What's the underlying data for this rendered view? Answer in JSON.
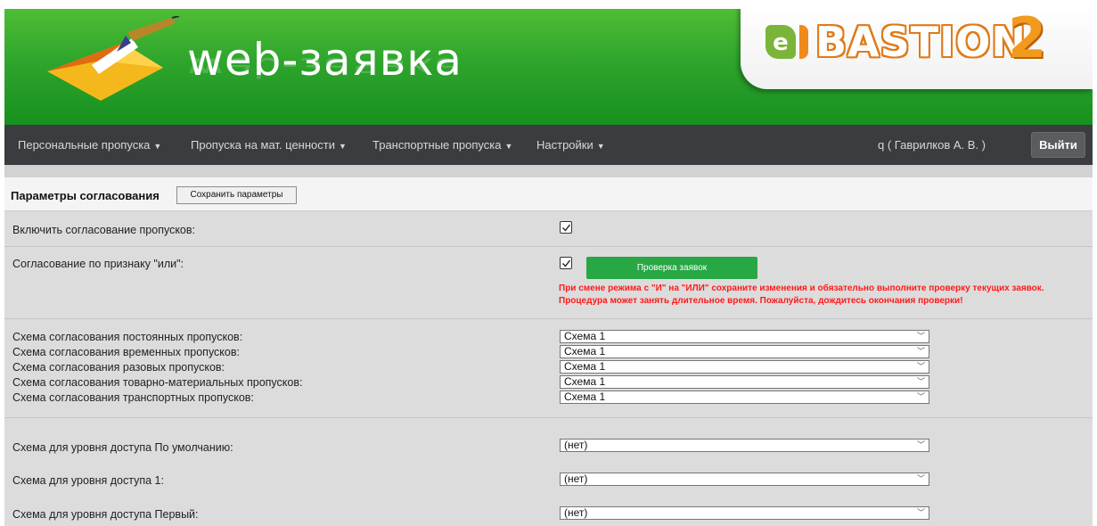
{
  "brand": {
    "app_name": "web-заявка",
    "partner_logo_text": "BASTION",
    "partner_logo_number": "2",
    "partner_logo_letter": "e"
  },
  "nav": {
    "items": [
      {
        "label": "Персональные пропуска"
      },
      {
        "label": "Пропуска на мат. ценности"
      },
      {
        "label": "Транспортные пропуска"
      },
      {
        "label": "Настройки"
      }
    ],
    "caret_icon": "caret-down-icon",
    "user": "q ( Гаврилков А. В. )",
    "logout_label": "Выйти"
  },
  "settings": {
    "title": "Параметры согласования",
    "save_label": "Сохранить параметры",
    "enable_label": "Включить согласование пропусков:",
    "enable_checked": true,
    "or_label": "Согласование по признаку \"или\":",
    "or_checked": true,
    "check_button": "Проверка заявок",
    "warning": "При смене режима с \"И\" на \"ИЛИ\" сохраните изменения и обязательно выполните проверку текущих заявок. Процедура может занять длительное время. Пожалуйста, дождитесь окончания проверки!",
    "warning_color": "#ff1a1a",
    "accent_color": "#28a745",
    "schemes": [
      {
        "label": "Схема согласования постоянных пропусков:",
        "value": "Схема 1"
      },
      {
        "label": "Схема согласования временных пропусков:",
        "value": "Схема 1"
      },
      {
        "label": "Схема согласования разовых пропусков:",
        "value": "Схема 1"
      },
      {
        "label": "Схема согласования товарно-материальных пропусков:",
        "value": "Схема 1"
      },
      {
        "label": "Схема согласования транспортных пропусков:",
        "value": "Схема 1"
      }
    ],
    "access_levels": [
      {
        "label": "Схема для уровня доступа По умолчанию:",
        "value": "(нет)"
      },
      {
        "label": "Схема для уровня доступа 1:",
        "value": "(нет)"
      },
      {
        "label": "Схема для уровня доступа Первый:",
        "value": "(нет)"
      }
    ]
  }
}
